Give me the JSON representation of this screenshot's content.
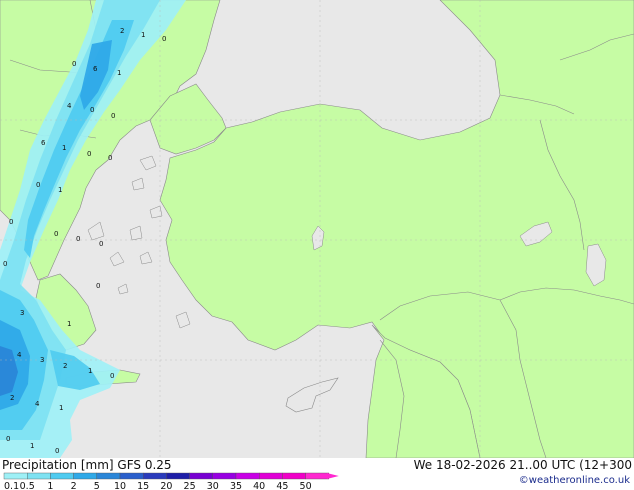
{
  "title": {
    "label": "Precipitation [mm]",
    "model": "GFS 0.25"
  },
  "valid_time": "We 18-02-2026 21..00 UTC (12+300",
  "credit": "©weatheronline.co.uk",
  "colors": {
    "land": "#c6fca4",
    "sea": "#e8e8e8",
    "border": "#8a8a8a",
    "scale": [
      "#9ef0f6",
      "#7ee2f2",
      "#4fcbf0",
      "#2fa9e8",
      "#2a86d8",
      "#2a5fcc",
      "#2a3bbc",
      "#1e1ea8",
      "#7800d2",
      "#9800e2",
      "#c800e6",
      "#e000d6",
      "#f000c8",
      "#ff28d0"
    ]
  },
  "scale": {
    "ticks": [
      "0.1",
      "0.5",
      "1",
      "2",
      "5",
      "10",
      "15",
      "20",
      "25",
      "30",
      "35",
      "40",
      "45",
      "50"
    ]
  },
  "map_labels": [
    "2",
    "1",
    "0",
    "0",
    "6",
    "1",
    "4",
    "0",
    "0",
    "6",
    "1",
    "0",
    "0",
    "0",
    "1",
    "0",
    "0",
    "0",
    "0",
    "0",
    "0",
    "3",
    "1",
    "4",
    "3",
    "2",
    "1",
    "0",
    "2",
    "4",
    "1",
    "0",
    "1",
    "0"
  ]
}
